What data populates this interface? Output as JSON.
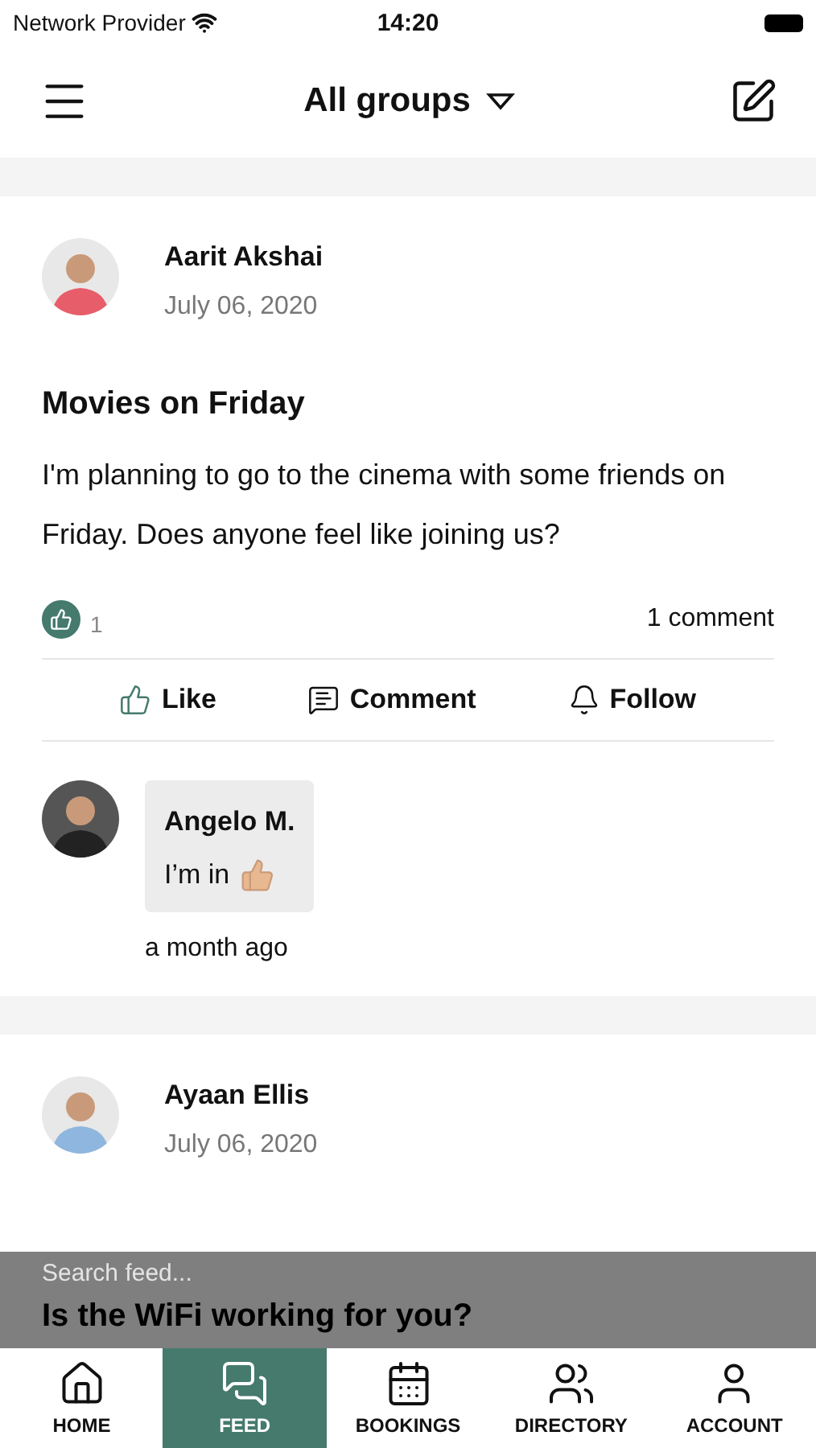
{
  "status_bar": {
    "carrier": "Network Provider",
    "time": "14:20"
  },
  "header": {
    "title": "All groups"
  },
  "posts": [
    {
      "author": "Aarit Akshai",
      "date": "July 06, 2020",
      "title": "Movies on Friday",
      "body": "I'm planning to go to the cinema with some friends on Friday. Does anyone feel like joining us?",
      "likes": "1",
      "liked": true,
      "comment_count": "1 comment",
      "actions": [
        {
          "kind": "like",
          "label": "Like"
        },
        {
          "kind": "comment",
          "label": "Comment"
        },
        {
          "kind": "follow",
          "label": "Follow"
        }
      ],
      "comments": [
        {
          "author": "Angelo M.",
          "text": "I’m in",
          "time": "a month ago"
        }
      ]
    },
    {
      "author": "Ayaan Ellis",
      "date": "July 06, 2020",
      "title": "Is the WiFi working for you?"
    }
  ],
  "search": {
    "placeholder": "Search feed..."
  },
  "tab_bar": [
    {
      "kind": "home",
      "label": "HOME",
      "selected": false
    },
    {
      "kind": "feed",
      "label": "FEED",
      "selected": true
    },
    {
      "kind": "bookings",
      "label": "BOOKINGS",
      "selected": false
    },
    {
      "kind": "directory",
      "label": "DIRECTORY",
      "selected": false
    },
    {
      "kind": "account",
      "label": "ACCOUNT",
      "selected": false
    }
  ]
}
